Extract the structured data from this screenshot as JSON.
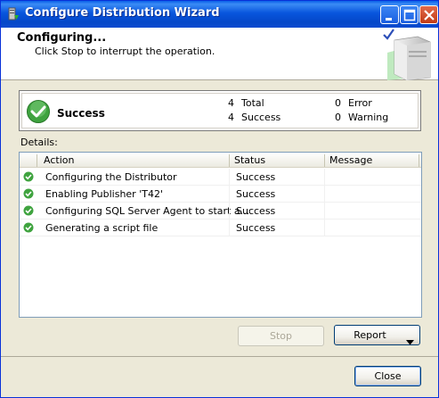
{
  "window": {
    "title": "Configure Distribution Wizard"
  },
  "header": {
    "title": "Configuring...",
    "subtitle": "Click Stop to interrupt the operation."
  },
  "summary": {
    "status": "Success",
    "total_count": "4",
    "total_label": "Total",
    "success_count": "4",
    "success_label": "Success",
    "error_count": "0",
    "error_label": "Error",
    "warning_count": "0",
    "warning_label": "Warning"
  },
  "details": {
    "label": "Details:",
    "columns": [
      "Action",
      "Status",
      "Message"
    ],
    "rows": [
      {
        "action": "Configuring the Distributor",
        "status": "Success",
        "message": ""
      },
      {
        "action": "Enabling Publisher 'T42'",
        "status": "Success",
        "message": ""
      },
      {
        "action": "Configuring SQL Server Agent to start a...",
        "status": "Success",
        "message": ""
      },
      {
        "action": "Generating a script file",
        "status": "Success",
        "message": ""
      }
    ]
  },
  "buttons": {
    "stop": "Stop",
    "report": "Report",
    "close": "Close"
  },
  "colors": {
    "success_green": "#3fa33f",
    "titlebar_blue": "#0855dd"
  },
  "icons": {
    "success": "check-circle-icon",
    "dropdown": "triangle-down-icon"
  }
}
